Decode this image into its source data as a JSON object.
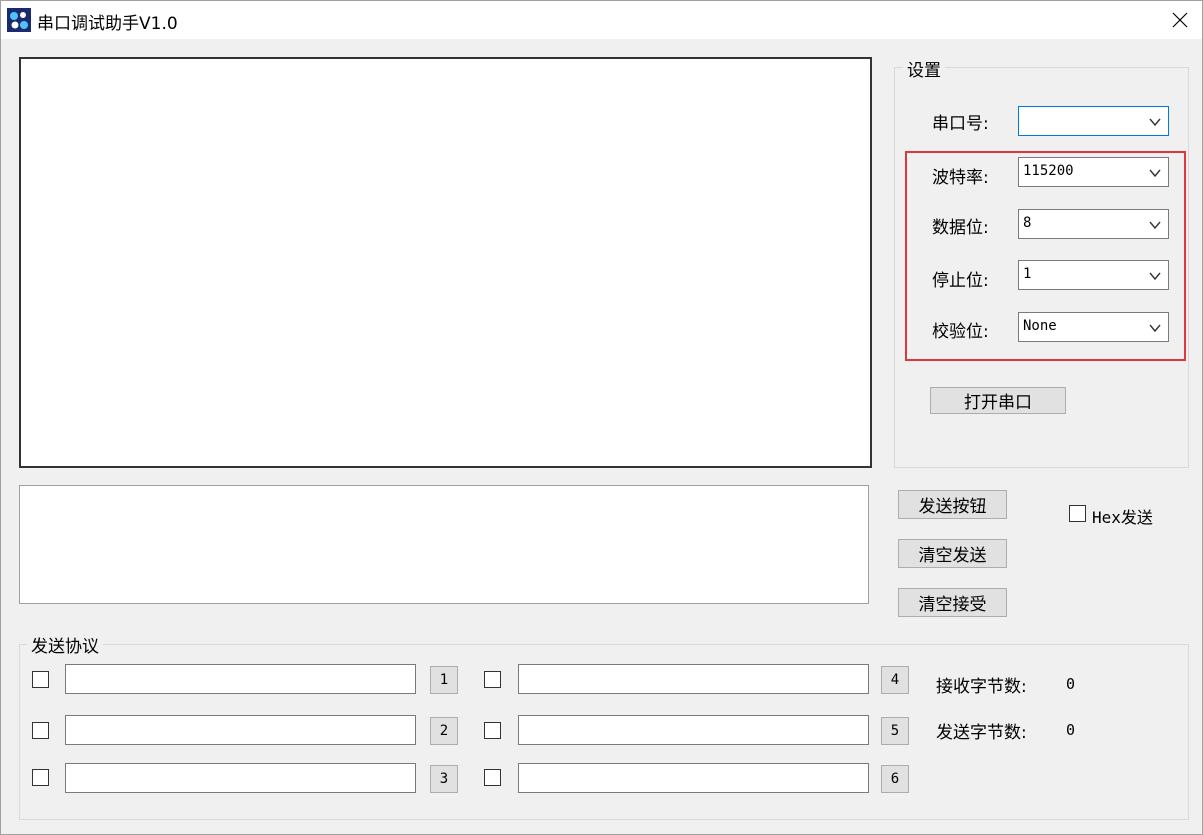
{
  "window": {
    "title": "串口调试助手V1.0"
  },
  "settings": {
    "group_title": "设置",
    "port_label": "串口号:",
    "port_value": "",
    "baud_label": "波特率:",
    "baud_value": "115200",
    "databits_label": "数据位:",
    "databits_value": "8",
    "stopbits_label": "停止位:",
    "stopbits_value": "1",
    "parity_label": "校验位:",
    "parity_value": "None",
    "open_button": "打开串口"
  },
  "send_controls": {
    "send_button": "发送按钮",
    "clear_send_button": "清空发送",
    "clear_recv_button": "清空接受",
    "hex_send_label": "Hex发送"
  },
  "protocol": {
    "group_title": "发送协议",
    "buttons": [
      "1",
      "2",
      "3",
      "4",
      "5",
      "6"
    ]
  },
  "stats": {
    "recv_bytes_label": "接收字节数:",
    "recv_bytes_value": "0",
    "send_bytes_label": "发送字节数:",
    "send_bytes_value": "0"
  },
  "colors": {
    "highlight_border": "#e0363c",
    "focus_border": "#0078d7",
    "window_bg": "#f0f0f0"
  },
  "icons": [
    "app-icon",
    "close-icon",
    "chevron-down-icon"
  ]
}
